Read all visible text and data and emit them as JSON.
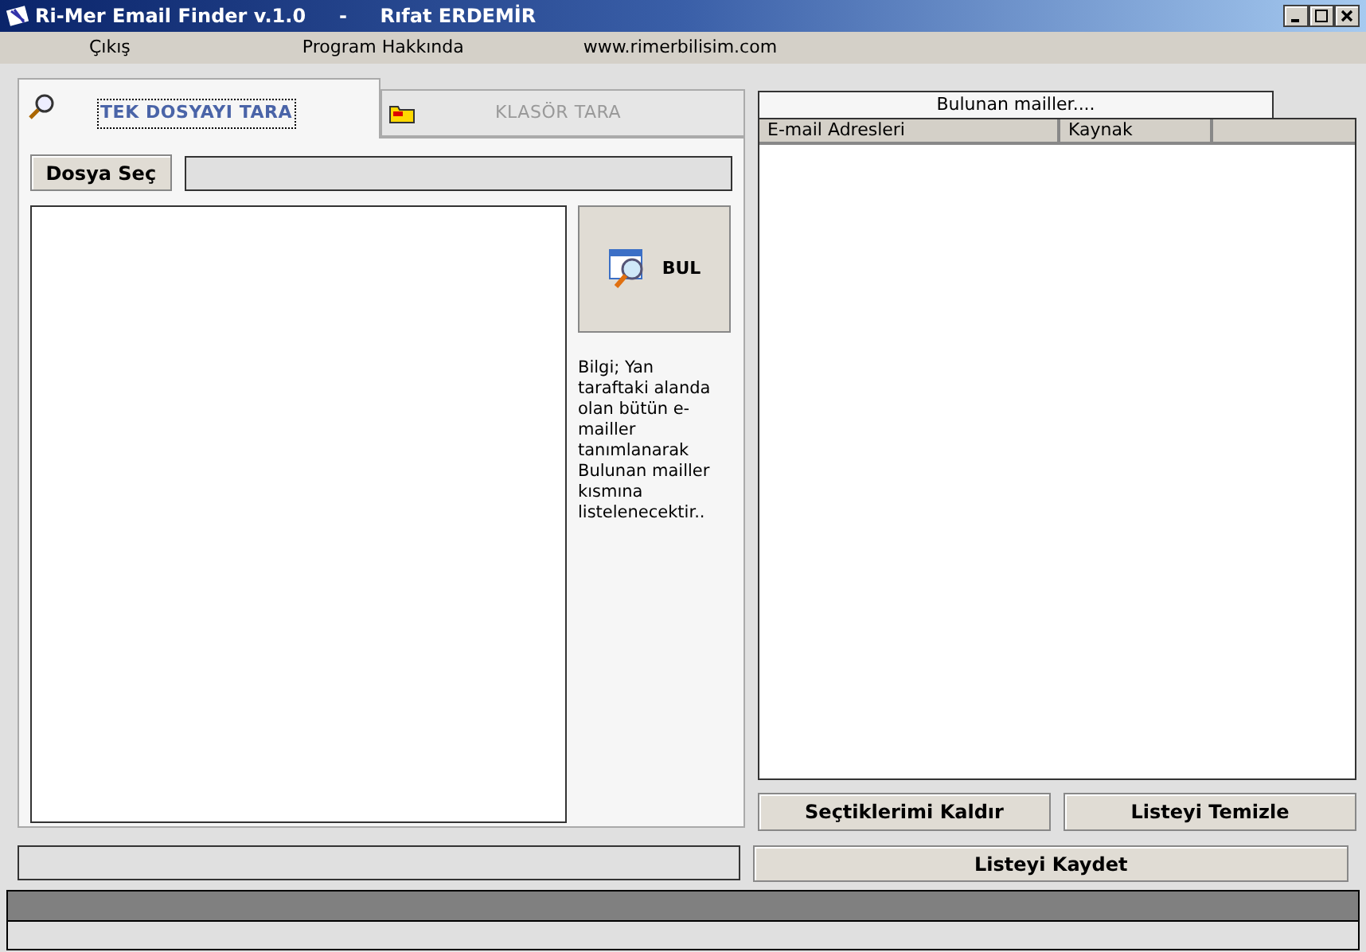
{
  "window": {
    "title": "Ri-Mer Email Finder v.1.0     -     Rıfat ERDEMİR"
  },
  "menu": [
    "Çıkış",
    "Program Hakkında",
    "www.rimerbilisim.com"
  ],
  "tabs": [
    {
      "label": "TEK DOSYAYI TARA",
      "selected": true,
      "kind": "search"
    },
    {
      "label": "KLASÖR TARA",
      "selected": false,
      "kind": "folder"
    }
  ],
  "select_file_button": "Dosya Seç",
  "find_button": "BUL",
  "info": "Bilgi; Yan taraftaki alanda olan bütün e-mailler tanımlanarak Bulunan mailler kısmına listelenecektir..",
  "results": {
    "title": "Bulunan mailler....",
    "columns": [
      "E-mail Adresleri",
      "Kaynak"
    ]
  },
  "buttons": [
    "Seçtiklerimi Kaldır",
    "Listeyi Temizle"
  ],
  "save_button": "Listeyi Kaydet"
}
